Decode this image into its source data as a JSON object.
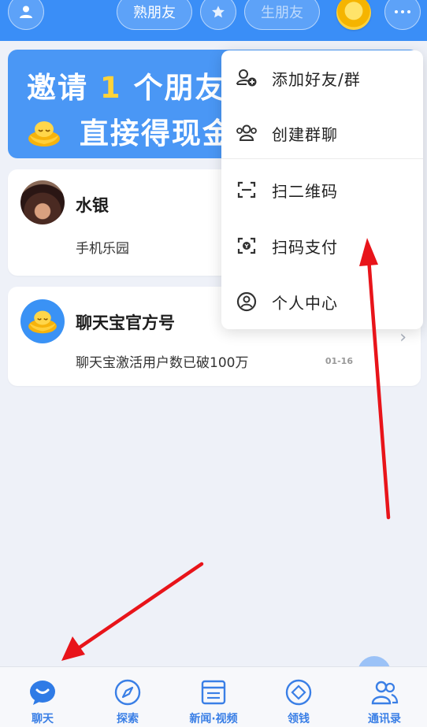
{
  "topbar": {
    "tab_familiar": "熟朋友",
    "tab_stranger": "生朋友"
  },
  "banner": {
    "line1_prefix": "邀请",
    "line1_number": "1",
    "line1_suffix": "个朋友",
    "line2_text": "直接得现金"
  },
  "chats": [
    {
      "name": "水银",
      "preview": "手机乐园",
      "time": "",
      "avatar_icon": "photo-avatar"
    },
    {
      "name": "聊天宝官方号",
      "preview": "聊天宝激活用户数已破100万",
      "time": "01-16",
      "avatar_icon": "gold-ingot-icon"
    }
  ],
  "menu": {
    "items": [
      {
        "label": "添加好友/群",
        "icon": "add-friend-icon"
      },
      {
        "label": "创建群聊",
        "icon": "group-icon"
      },
      {
        "label": "扫二维码",
        "icon": "scan-icon"
      },
      {
        "label": "扫码支付",
        "icon": "scan-pay-icon"
      },
      {
        "label": "个人中心",
        "icon": "profile-icon"
      }
    ]
  },
  "bottom_nav": [
    {
      "label": "聊天",
      "icon": "chat-icon",
      "active": true
    },
    {
      "label": "探索",
      "icon": "compass-icon"
    },
    {
      "label": "新闻·视频",
      "icon": "news-icon"
    },
    {
      "label": "领钱",
      "icon": "money-icon"
    },
    {
      "label": "通讯录",
      "icon": "contacts-icon"
    }
  ],
  "colors": {
    "primary": "#3a8ef7",
    "banner_highlight": "#ffd33a",
    "annotation_arrow": "#e8141a",
    "nav_active": "#3a7fe6"
  }
}
